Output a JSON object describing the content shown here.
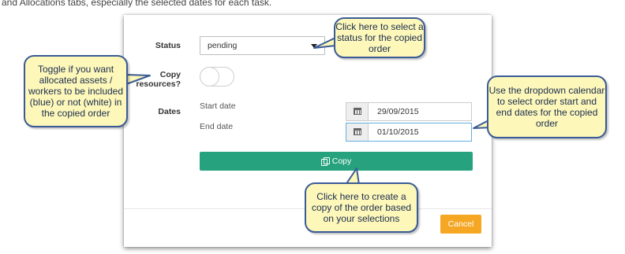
{
  "intro_text": "and Allocations tabs, especially the selected dates for each task.",
  "form": {
    "status_label": "Status",
    "status_value": "pending",
    "copy_resources_label_line1": "Copy",
    "copy_resources_label_line2": "resources?",
    "copy_resources_on": false,
    "dates_label": "Dates",
    "start_date_label": "Start date",
    "end_date_label": "End date",
    "start_date_value": "29/09/2015",
    "end_date_value": "01/10/2015",
    "copy_button_label": "Copy",
    "cancel_button_label": "Cancel"
  },
  "callouts": {
    "status": "Click here to select a status for the copied order",
    "toggle": "Toggle if you want allocated assets / workers to be included (blue) or not (white) in the copied order",
    "dates": "Use the dropdown calendar to select order start and end dates for the copied order",
    "copy": "Click here to create a copy of the order based on your selections"
  },
  "colors": {
    "copy_button": "#26a37e",
    "cancel_button": "#f5a623",
    "callout_fill": "#fdf7b9",
    "callout_border": "#3a5b96"
  },
  "icons": {
    "status_caret": "chevron-down-icon",
    "date_picker": "calendar-icon",
    "copy": "copy-icon"
  }
}
